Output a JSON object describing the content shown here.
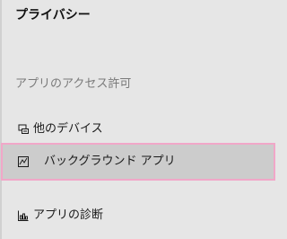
{
  "header": {
    "title": "プライバシー"
  },
  "section": {
    "title": "アプリのアクセス許可"
  },
  "nav": {
    "items": [
      {
        "label": "他のデバイス",
        "icon": "devices-icon",
        "selected": false
      },
      {
        "label": "バックグラウンド アプリ",
        "icon": "background-apps-icon",
        "selected": true
      },
      {
        "label": "アプリの診断",
        "icon": "app-diagnostics-icon",
        "selected": false
      }
    ]
  },
  "colors": {
    "background": "#e6e6e6",
    "selected_background": "#cccccc",
    "focus_outline": "#f1a7c8",
    "section_header": "#7a7a7a"
  }
}
